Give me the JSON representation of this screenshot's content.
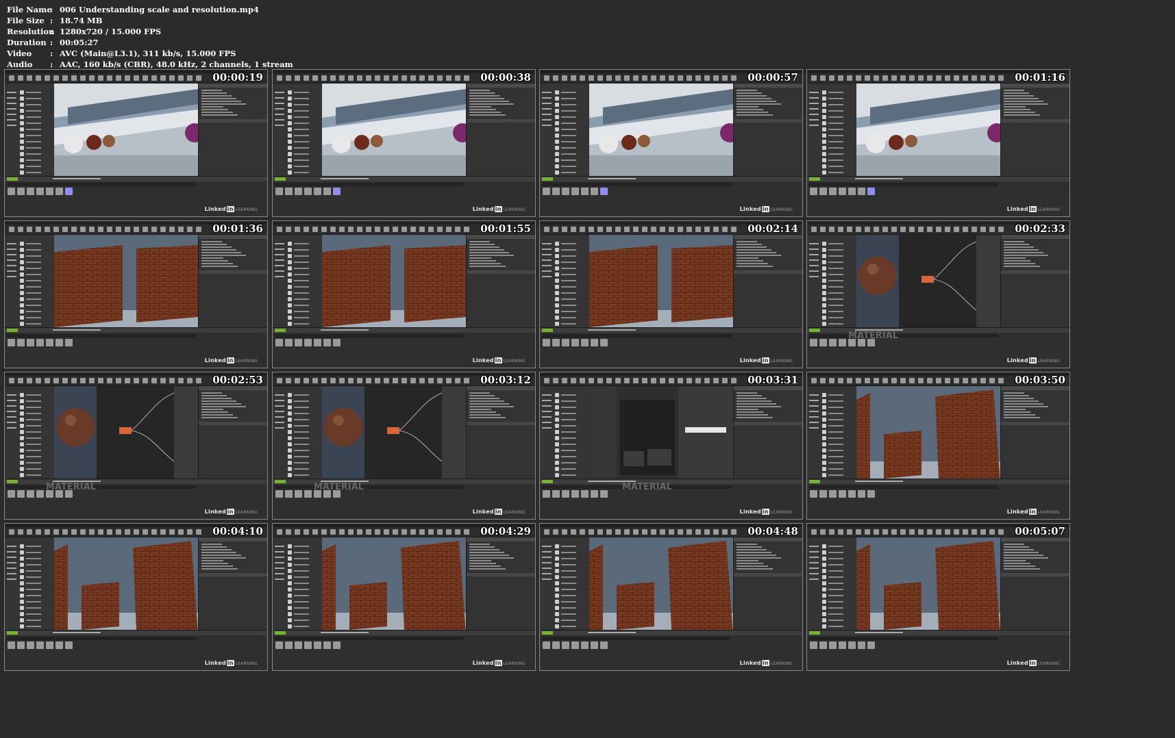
{
  "file_info": {
    "rows": [
      {
        "key": "File Name",
        "value": "006 Understanding scale and resolution.mp4"
      },
      {
        "key": "File Size",
        "value": "18.74 MB"
      },
      {
        "key": "Resolution",
        "value": "1280x720 / 15.000 FPS"
      },
      {
        "key": "Duration",
        "value": "00:05:27"
      },
      {
        "key": "Video",
        "value": "AVC (Main@L3.1), 311 kb/s, 15.000 FPS"
      },
      {
        "key": "Audio",
        "value": "AAC, 160 kb/s (CBR), 48.0 kHz, 2 channels, 1 stream"
      }
    ]
  },
  "watermark": {
    "brand": "Linked",
    "in": "in",
    "learning": "LEARNING"
  },
  "material_label": "MATERIAL",
  "thumbnails": [
    {
      "timestamp": "00:00:19",
      "scene": "room"
    },
    {
      "timestamp": "00:00:38",
      "scene": "room"
    },
    {
      "timestamp": "00:00:57",
      "scene": "room"
    },
    {
      "timestamp": "00:01:16",
      "scene": "room"
    },
    {
      "timestamp": "00:01:36",
      "scene": "bricks"
    },
    {
      "timestamp": "00:01:55",
      "scene": "bricks"
    },
    {
      "timestamp": "00:02:14",
      "scene": "bricks"
    },
    {
      "timestamp": "00:02:33",
      "scene": "material"
    },
    {
      "timestamp": "00:02:53",
      "scene": "material"
    },
    {
      "timestamp": "00:03:12",
      "scene": "material"
    },
    {
      "timestamp": "00:03:31",
      "scene": "blueprint"
    },
    {
      "timestamp": "00:03:50",
      "scene": "bricks-angled"
    },
    {
      "timestamp": "00:04:10",
      "scene": "bricks-angled"
    },
    {
      "timestamp": "00:04:29",
      "scene": "bricks-angled"
    },
    {
      "timestamp": "00:04:48",
      "scene": "bricks-angled"
    },
    {
      "timestamp": "00:05:07",
      "scene": "bricks-angled"
    }
  ],
  "colors": {
    "background": "#2b2b2b",
    "editor_panel": "#353535",
    "brick": "#7a3a22",
    "accent_green": "#76b234",
    "asset_purple": "#8e8ef2"
  }
}
